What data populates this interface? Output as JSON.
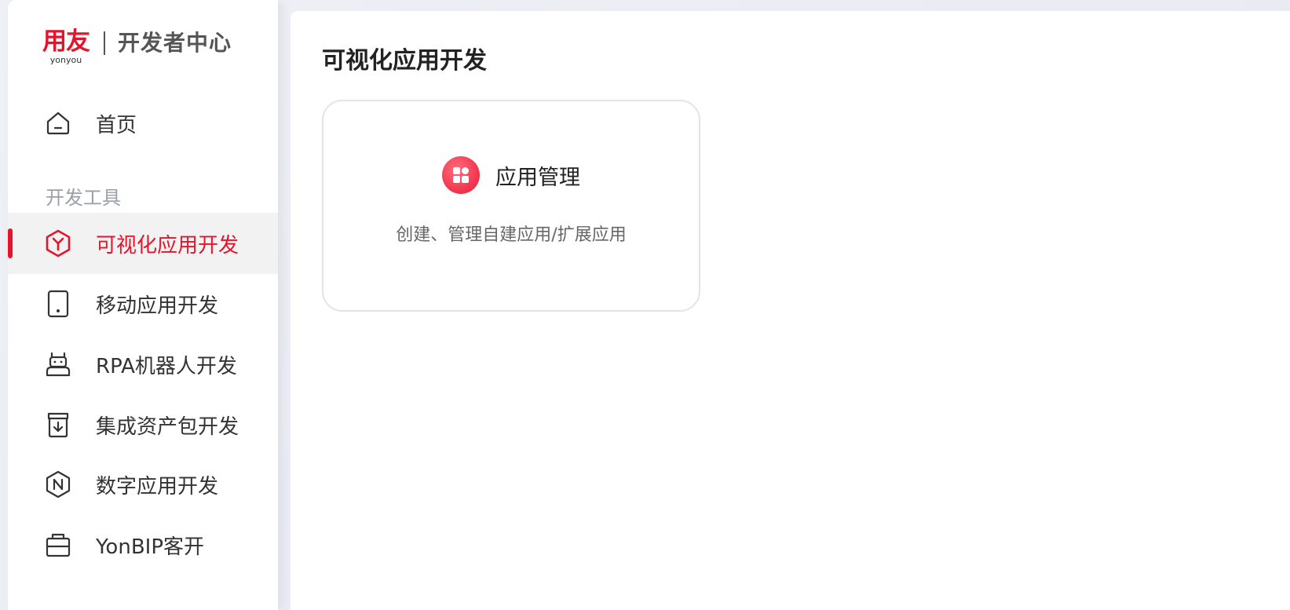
{
  "brand": {
    "logo_main": "用友",
    "logo_sub": "yonyou",
    "portal_title": "开发者中心",
    "accent_color": "#e5142a"
  },
  "sidebar": {
    "home": {
      "label": "首页",
      "icon": "home-icon"
    },
    "section_label": "开发工具",
    "items": [
      {
        "label": "可视化应用开发",
        "icon": "visual-app-icon",
        "active": true
      },
      {
        "label": "移动应用开发",
        "icon": "tablet-icon",
        "active": false
      },
      {
        "label": "RPA机器人开发",
        "icon": "robot-icon",
        "active": false
      },
      {
        "label": "集成资产包开发",
        "icon": "package-icon",
        "active": false
      },
      {
        "label": "数字应用开发",
        "icon": "digital-app-icon",
        "active": false
      },
      {
        "label": "YonBIP客开",
        "icon": "briefcase-icon",
        "active": false
      }
    ]
  },
  "main": {
    "title": "可视化应用开发",
    "cards": [
      {
        "title": "应用管理",
        "description": "创建、管理自建应用/扩展应用",
        "icon": "app-grid-icon"
      }
    ]
  }
}
